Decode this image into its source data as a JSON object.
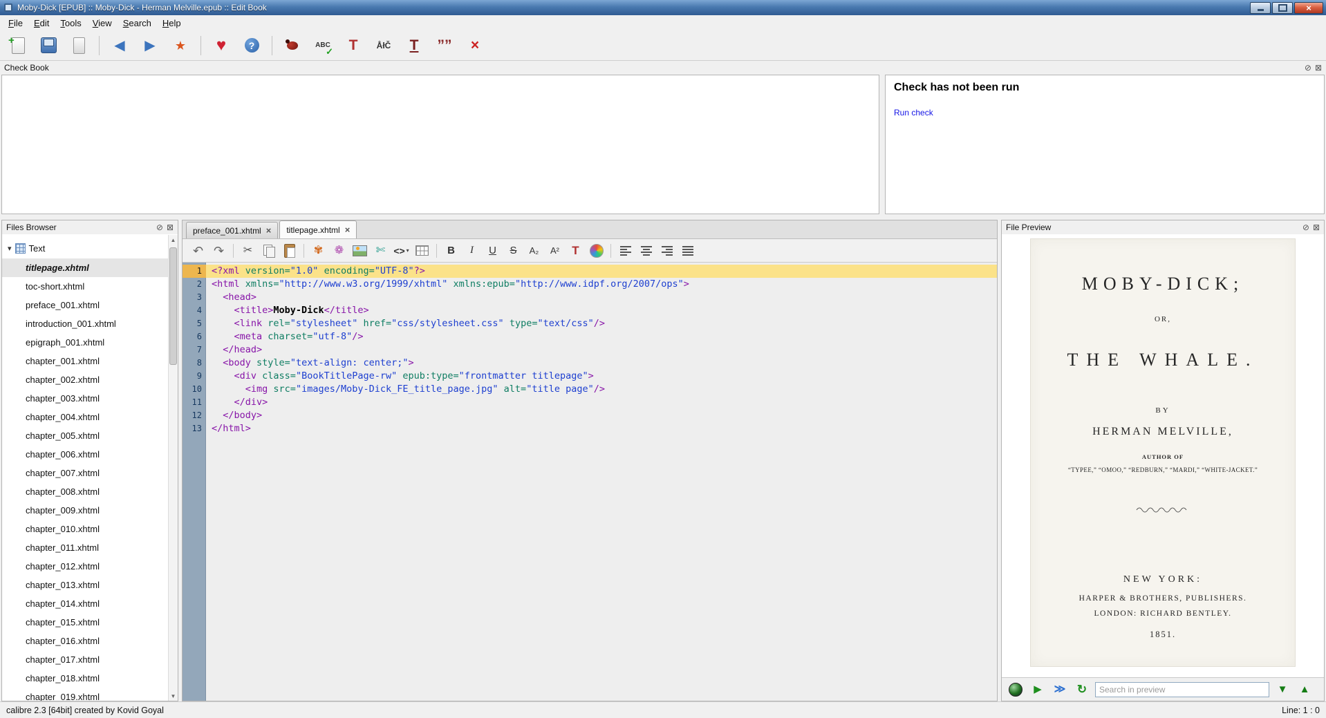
{
  "window": {
    "title": "Moby-Dick [EPUB] :: Moby-Dick - Herman Melville.epub :: Edit Book"
  },
  "icons": {
    "window_close": "×",
    "float_dock": "⊘",
    "close_dock": "⊠",
    "scroll_up": "▲",
    "scroll_down": "▼",
    "chevron_down": "▾",
    "tree_expanded": "▾"
  },
  "menu": {
    "items": [
      "File",
      "Edit",
      "Tools",
      "View",
      "Search",
      "Help"
    ]
  },
  "main_toolbar": {
    "buttons": [
      {
        "name": "new-file-icon",
        "kind": "doc-new"
      },
      {
        "name": "save-icon",
        "kind": "save"
      },
      {
        "name": "book-icon",
        "kind": "card"
      },
      {
        "name": "sep"
      },
      {
        "name": "back-icon",
        "glyph": "◀",
        "color": "#3c74bd",
        "size": 20
      },
      {
        "name": "forward-icon",
        "glyph": "▶",
        "color": "#3c74bd",
        "size": 20
      },
      {
        "name": "mark-text-icon",
        "glyph": "★",
        "color": "#da551e",
        "size": 18
      },
      {
        "name": "sep"
      },
      {
        "name": "donate-icon",
        "glyph": "♥",
        "color": "#cf2233",
        "size": 24
      },
      {
        "name": "help-icon",
        "kind": "help",
        "glyph": "?"
      },
      {
        "name": "sep"
      },
      {
        "name": "check-book-icon",
        "kind": "bug"
      },
      {
        "name": "spellcheck-icon",
        "kind": "abc",
        "glyph": "ABC"
      },
      {
        "name": "embed-fonts-icon",
        "glyph": "T",
        "color": "#b03030",
        "size": 21,
        "bold": true
      },
      {
        "name": "transliterate-icon",
        "glyph": "ÅłČ",
        "color": "#333333",
        "size": 12,
        "bold": true
      },
      {
        "name": "subset-fonts-icon",
        "kind": "t-strike",
        "glyph": "T",
        "color": "#7a2020",
        "size": 21,
        "bold": true
      },
      {
        "name": "smarten-punctuation-icon",
        "glyph": "””",
        "color": "#8a2a2a",
        "size": 21,
        "bold": true
      },
      {
        "name": "remove-unused-css-icon",
        "glyph": "×",
        "color": "#cc2222",
        "size": 21,
        "bold": true
      }
    ]
  },
  "check_book": {
    "panel_title": "Check Book",
    "heading": "Check has not been run",
    "link": "Run check"
  },
  "files_browser": {
    "panel_title": "Files Browser",
    "root": "Text",
    "selected": "titlepage.xhtml",
    "files": [
      "titlepage.xhtml",
      "toc-short.xhtml",
      "preface_001.xhtml",
      "introduction_001.xhtml",
      "epigraph_001.xhtml",
      "chapter_001.xhtml",
      "chapter_002.xhtml",
      "chapter_003.xhtml",
      "chapter_004.xhtml",
      "chapter_005.xhtml",
      "chapter_006.xhtml",
      "chapter_007.xhtml",
      "chapter_008.xhtml",
      "chapter_009.xhtml",
      "chapter_010.xhtml",
      "chapter_011.xhtml",
      "chapter_012.xhtml",
      "chapter_013.xhtml",
      "chapter_014.xhtml",
      "chapter_015.xhtml",
      "chapter_016.xhtml",
      "chapter_017.xhtml",
      "chapter_018.xhtml",
      "chapter_019.xhtml"
    ]
  },
  "editor": {
    "close_glyph": "×",
    "tabs": [
      {
        "label": "preface_001.xhtml",
        "active": false
      },
      {
        "label": "titlepage.xhtml",
        "active": true
      }
    ],
    "toolbar": {
      "buttons": [
        {
          "name": "undo-icon",
          "glyph": "↶",
          "color": "#666666",
          "size": 18
        },
        {
          "name": "redo-icon",
          "glyph": "↷",
          "color": "#666666",
          "size": 18
        },
        {
          "name": "sep"
        },
        {
          "name": "cut-icon",
          "glyph": "✂",
          "color": "#555555",
          "size": 16
        },
        {
          "name": "copy-icon",
          "kind": "copy"
        },
        {
          "name": "paste-icon",
          "kind": "paste"
        },
        {
          "name": "sep"
        },
        {
          "name": "special-character-icon",
          "glyph": "✾",
          "color": "#d2691e",
          "size": 16
        },
        {
          "name": "insert-snippet-icon",
          "glyph": "❁",
          "color": "#b050b0",
          "size": 16
        },
        {
          "name": "insert-image-icon",
          "kind": "photo"
        },
        {
          "name": "split-file-icon",
          "glyph": "✄",
          "color": "#2a9d8f",
          "size": 16
        },
        {
          "name": "insert-tag-icon",
          "glyph": "<>",
          "color": "#333333",
          "size": 14,
          "bold": true,
          "chevron": true
        },
        {
          "name": "insert-table-icon",
          "kind": "grid"
        },
        {
          "name": "sep"
        },
        {
          "name": "bold-icon",
          "glyph": "B",
          "color": "#333333",
          "size": 15,
          "bold": true
        },
        {
          "name": "italic-icon",
          "glyph": "I",
          "color": "#333333",
          "size": 15,
          "italic": true,
          "serif": true
        },
        {
          "name": "underline-icon",
          "glyph": "U",
          "color": "#333333",
          "size": 15,
          "underline": true
        },
        {
          "name": "strikethrough-icon",
          "glyph": "S",
          "color": "#333333",
          "size": 15,
          "strike": true
        },
        {
          "name": "subscript-icon",
          "glyph": "A₂",
          "color": "#333333",
          "size": 13
        },
        {
          "name": "superscript-icon",
          "glyph": "A²",
          "color": "#333333",
          "size": 13
        },
        {
          "name": "text-color-icon",
          "glyph": "T",
          "color": "#b03030",
          "size": 17,
          "bold": true
        },
        {
          "name": "background-color-icon",
          "kind": "palette"
        },
        {
          "name": "sep"
        },
        {
          "name": "align-left-icon",
          "kind": "align-left"
        },
        {
          "name": "align-center-icon",
          "kind": "align-center"
        },
        {
          "name": "align-right-icon",
          "kind": "align-right"
        },
        {
          "name": "align-justify-icon",
          "kind": "align-justify"
        }
      ]
    },
    "lines": [
      {
        "current": true,
        "tokens": [
          [
            "tag",
            "<?xml"
          ],
          [
            "attr",
            " version="
          ],
          [
            "val",
            "\"1.0\""
          ],
          [
            "attr",
            " encoding="
          ],
          [
            "val",
            "\"UTF-8\""
          ],
          [
            "tag",
            "?>"
          ]
        ]
      },
      {
        "tokens": [
          [
            "tag",
            "<html"
          ],
          [
            "attr",
            " xmlns="
          ],
          [
            "val",
            "\"http://www.w3.org/1999/xhtml\""
          ],
          [
            "attr",
            " xmlns:epub="
          ],
          [
            "val",
            "\"http://www.idpf.org/2007/ops\""
          ],
          [
            "tag",
            ">"
          ]
        ]
      },
      {
        "tokens": [
          [
            "plain",
            "  "
          ],
          [
            "tag",
            "<head>"
          ]
        ]
      },
      {
        "tokens": [
          [
            "plain",
            "    "
          ],
          [
            "tag",
            "<title>"
          ],
          [
            "btext",
            "Moby-Dick"
          ],
          [
            "tag",
            "</title>"
          ]
        ]
      },
      {
        "tokens": [
          [
            "plain",
            "    "
          ],
          [
            "tag",
            "<link"
          ],
          [
            "attr",
            " rel="
          ],
          [
            "val",
            "\"stylesheet\""
          ],
          [
            "attr",
            " href="
          ],
          [
            "val",
            "\"css/stylesheet.css\""
          ],
          [
            "attr",
            " type="
          ],
          [
            "val",
            "\"text/css\""
          ],
          [
            "tag",
            "/>"
          ]
        ]
      },
      {
        "tokens": [
          [
            "plain",
            "    "
          ],
          [
            "tag",
            "<meta"
          ],
          [
            "attr",
            " charset="
          ],
          [
            "val",
            "\"utf-8\""
          ],
          [
            "tag",
            "/>"
          ]
        ]
      },
      {
        "tokens": [
          [
            "plain",
            "  "
          ],
          [
            "tag",
            "</head>"
          ]
        ]
      },
      {
        "tokens": [
          [
            "plain",
            "  "
          ],
          [
            "tag",
            "<body"
          ],
          [
            "attr",
            " style="
          ],
          [
            "val",
            "\"text-align: center;\""
          ],
          [
            "tag",
            ">"
          ]
        ]
      },
      {
        "tokens": [
          [
            "plain",
            "    "
          ],
          [
            "tag",
            "<div"
          ],
          [
            "attr",
            " class="
          ],
          [
            "val",
            "\"BookTitlePage-rw\""
          ],
          [
            "attr",
            " epub:type="
          ],
          [
            "val",
            "\"frontmatter titlepage\""
          ],
          [
            "tag",
            ">"
          ]
        ]
      },
      {
        "tokens": [
          [
            "plain",
            "      "
          ],
          [
            "tag",
            "<img"
          ],
          [
            "attr",
            " src="
          ],
          [
            "val",
            "\"images/Moby-Dick_FE_title_page.jpg\""
          ],
          [
            "attr",
            " alt="
          ],
          [
            "val",
            "\"title page\""
          ],
          [
            "tag",
            "/>"
          ]
        ]
      },
      {
        "tokens": [
          [
            "plain",
            "    "
          ],
          [
            "tag",
            "</div>"
          ]
        ]
      },
      {
        "tokens": [
          [
            "plain",
            "  "
          ],
          [
            "tag",
            "</body>"
          ]
        ]
      },
      {
        "tokens": [
          [
            "tag",
            "</html>"
          ]
        ]
      }
    ]
  },
  "preview": {
    "panel_title": "File Preview",
    "search_placeholder": "Search in preview",
    "page": {
      "title": "MOBY-DICK;",
      "or": "OR,",
      "subtitle": "THE WHALE.",
      "by": "BY",
      "author": "HERMAN MELVILLE,",
      "author_of": "AUTHOR OF",
      "works": "“TYPEE,” “OMOO,” “REDBURN,” “MARDI,” “WHITE-JACKET.”",
      "city": "NEW YORK:",
      "publisher": "HARPER & BROTHERS, PUBLISHERS.",
      "london": "LONDON: RICHARD BENTLEY.",
      "year": "1851."
    }
  },
  "preview_bar": {
    "buttons": [
      {
        "name": "live-preview-icon",
        "kind": "sphere"
      },
      {
        "name": "run-preview-icon",
        "glyph": "▶",
        "color": "#1e8f1e",
        "size": 15
      },
      {
        "name": "sync-preview-icon",
        "glyph": "≫",
        "color": "#2c6fd0",
        "size": 16,
        "bold": true
      },
      {
        "name": "refresh-preview-icon",
        "glyph": "↻",
        "color": "#1e8f1e",
        "size": 17,
        "bold": true
      }
    ],
    "next_glyph": "▼",
    "prev_glyph": "▲"
  },
  "status_bar": {
    "left": "calibre 2.3 [64bit] created by Kovid Goyal",
    "right": "Line: 1 : 0"
  }
}
